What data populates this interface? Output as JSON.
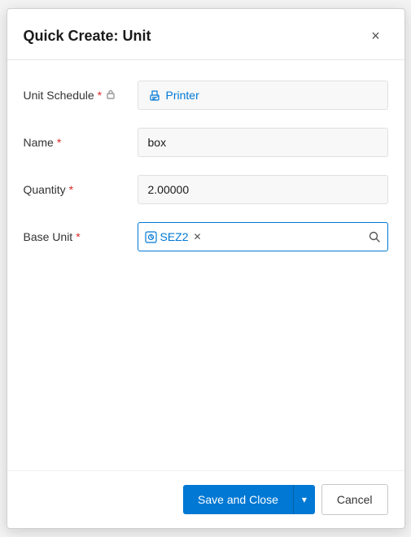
{
  "dialog": {
    "title": "Quick Create: Unit",
    "close_label": "×"
  },
  "form": {
    "unit_schedule": {
      "label": "Unit Schedule",
      "required": true,
      "locked": true,
      "value": "Printer",
      "link": true
    },
    "name": {
      "label": "Name",
      "required": true,
      "value": "box"
    },
    "quantity": {
      "label": "Quantity",
      "required": true,
      "value": "2.00000"
    },
    "base_unit": {
      "label": "Base Unit",
      "required": true,
      "tag": "SEZ2"
    }
  },
  "footer": {
    "save_and_close": "Save and Close",
    "dropdown_arrow": "▾",
    "cancel": "Cancel"
  }
}
